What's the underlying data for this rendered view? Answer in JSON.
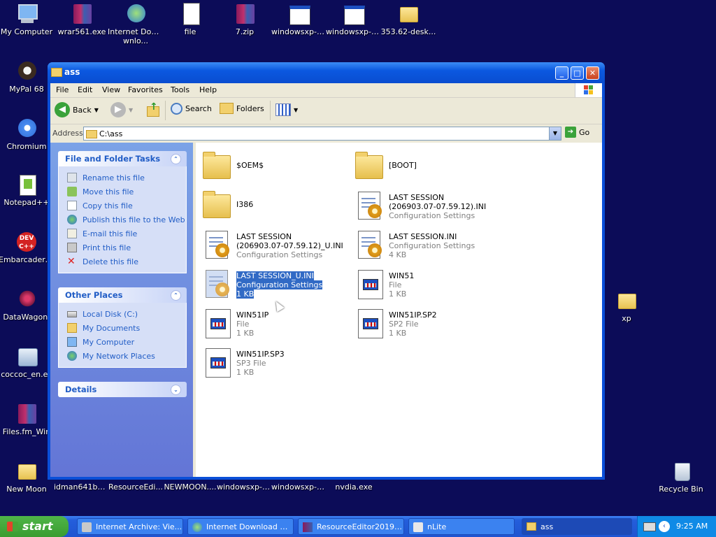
{
  "desktop_icons": [
    {
      "label": "My Computer",
      "icon": "computer-icon"
    },
    {
      "label": "wrar561.exe",
      "icon": "winrar-icon"
    },
    {
      "label": "Internet Downlo...",
      "icon": "idm-icon"
    },
    {
      "label": "file",
      "icon": "file-icon"
    },
    {
      "label": "7.zip",
      "icon": "winrar-icon"
    },
    {
      "label": "windowsxp-k...",
      "icon": "exe-icon"
    },
    {
      "label": "windowsxp-k...",
      "icon": "exe-icon"
    },
    {
      "label": "353.62-desk...",
      "icon": "folder-icon"
    },
    {
      "label": "MyPal 68",
      "icon": "mypal-icon"
    },
    {
      "label": "Chromium",
      "icon": "chromium-icon"
    },
    {
      "label": "Notepad++",
      "icon": "notepadpp-icon"
    },
    {
      "label": "Embarcadero Dev-C++",
      "icon": "devcpp-icon"
    },
    {
      "label": "DataWagon.",
      "icon": "datawagon-icon"
    },
    {
      "label": "coccoc_en.ex",
      "icon": "installer-icon"
    },
    {
      "label": "Files.fm_Win",
      "icon": "winrar-icon"
    },
    {
      "label": "New Moon",
      "icon": "folder-icon"
    },
    {
      "label": "idman641buil...",
      "icon": "exe-icon"
    },
    {
      "label": "ResourceEdi...",
      "icon": "exe-icon"
    },
    {
      "label": "NEWMOON....",
      "icon": "exe-icon"
    },
    {
      "label": "windowsxp-k...",
      "icon": "exe-icon"
    },
    {
      "label": "windowsxp-k...",
      "icon": "exe-icon"
    },
    {
      "label": "nvdia.exe",
      "icon": "exe-icon"
    },
    {
      "label": "xp",
      "icon": "folder-icon"
    },
    {
      "label": "Recycle Bin",
      "icon": "recycle-bin-icon"
    }
  ],
  "window": {
    "title": "ass",
    "menu": [
      "File",
      "Edit",
      "View",
      "Favorites",
      "Tools",
      "Help"
    ],
    "toolbar": {
      "back": "Back",
      "search": "Search",
      "folders": "Folders"
    },
    "address_label": "Address",
    "address_value": "C:\\ass",
    "go": "Go"
  },
  "file_tasks": {
    "title": "File and Folder Tasks",
    "items": [
      "Rename this file",
      "Move this file",
      "Copy this file",
      "Publish this file to the Web",
      "E-mail this file",
      "Print this file",
      "Delete this file"
    ]
  },
  "other_places": {
    "title": "Other Places",
    "items": [
      "Local Disk (C:)",
      "My Documents",
      "My Computer",
      "My Network Places"
    ]
  },
  "details": {
    "title": "Details"
  },
  "files": [
    {
      "name": "$OEM$",
      "line2": "",
      "line3": "",
      "kind": "folder"
    },
    {
      "name": "[BOOT]",
      "line2": "",
      "line3": "",
      "kind": "folder"
    },
    {
      "name": "I386",
      "line2": "",
      "line3": "",
      "kind": "folder"
    },
    {
      "name": "LAST SESSION",
      "line2": "(206903.07-07.59.12).INI",
      "line3": "Configuration Settings",
      "kind": "ini"
    },
    {
      "name": "LAST SESSION",
      "line2": "(206903.07-07.59.12)_U.INI",
      "line3": "Configuration Settings",
      "kind": "ini"
    },
    {
      "name": "LAST SESSION.INI",
      "line2": "Configuration Settings",
      "line3": "4 KB",
      "kind": "ini"
    },
    {
      "name": "LAST SESSION_U.INI",
      "line2": "Configuration Settings",
      "line3": "1 KB",
      "kind": "ini",
      "selected": true
    },
    {
      "name": "WIN51",
      "line2": "File",
      "line3": "1 KB",
      "kind": "exe"
    },
    {
      "name": "WIN51IP",
      "line2": "File",
      "line3": "1 KB",
      "kind": "exe"
    },
    {
      "name": "WIN51IP.SP2",
      "line2": "SP2 File",
      "line3": "1 KB",
      "kind": "exe"
    },
    {
      "name": "WIN51IP.SP3",
      "line2": "SP3 File",
      "line3": "1 KB",
      "kind": "exe"
    }
  ],
  "taskbar": {
    "start": "start",
    "buttons": [
      "Internet Archive: Vie...",
      "Internet Download M...",
      "ResourceEditor20190...",
      "nLite",
      "ass"
    ],
    "clock": "9:25 AM"
  },
  "colors": {
    "desktop": "#0c0c58",
    "xp_blue": "#0a4fd8",
    "link": "#215dc6",
    "selection": "#316ac5"
  }
}
